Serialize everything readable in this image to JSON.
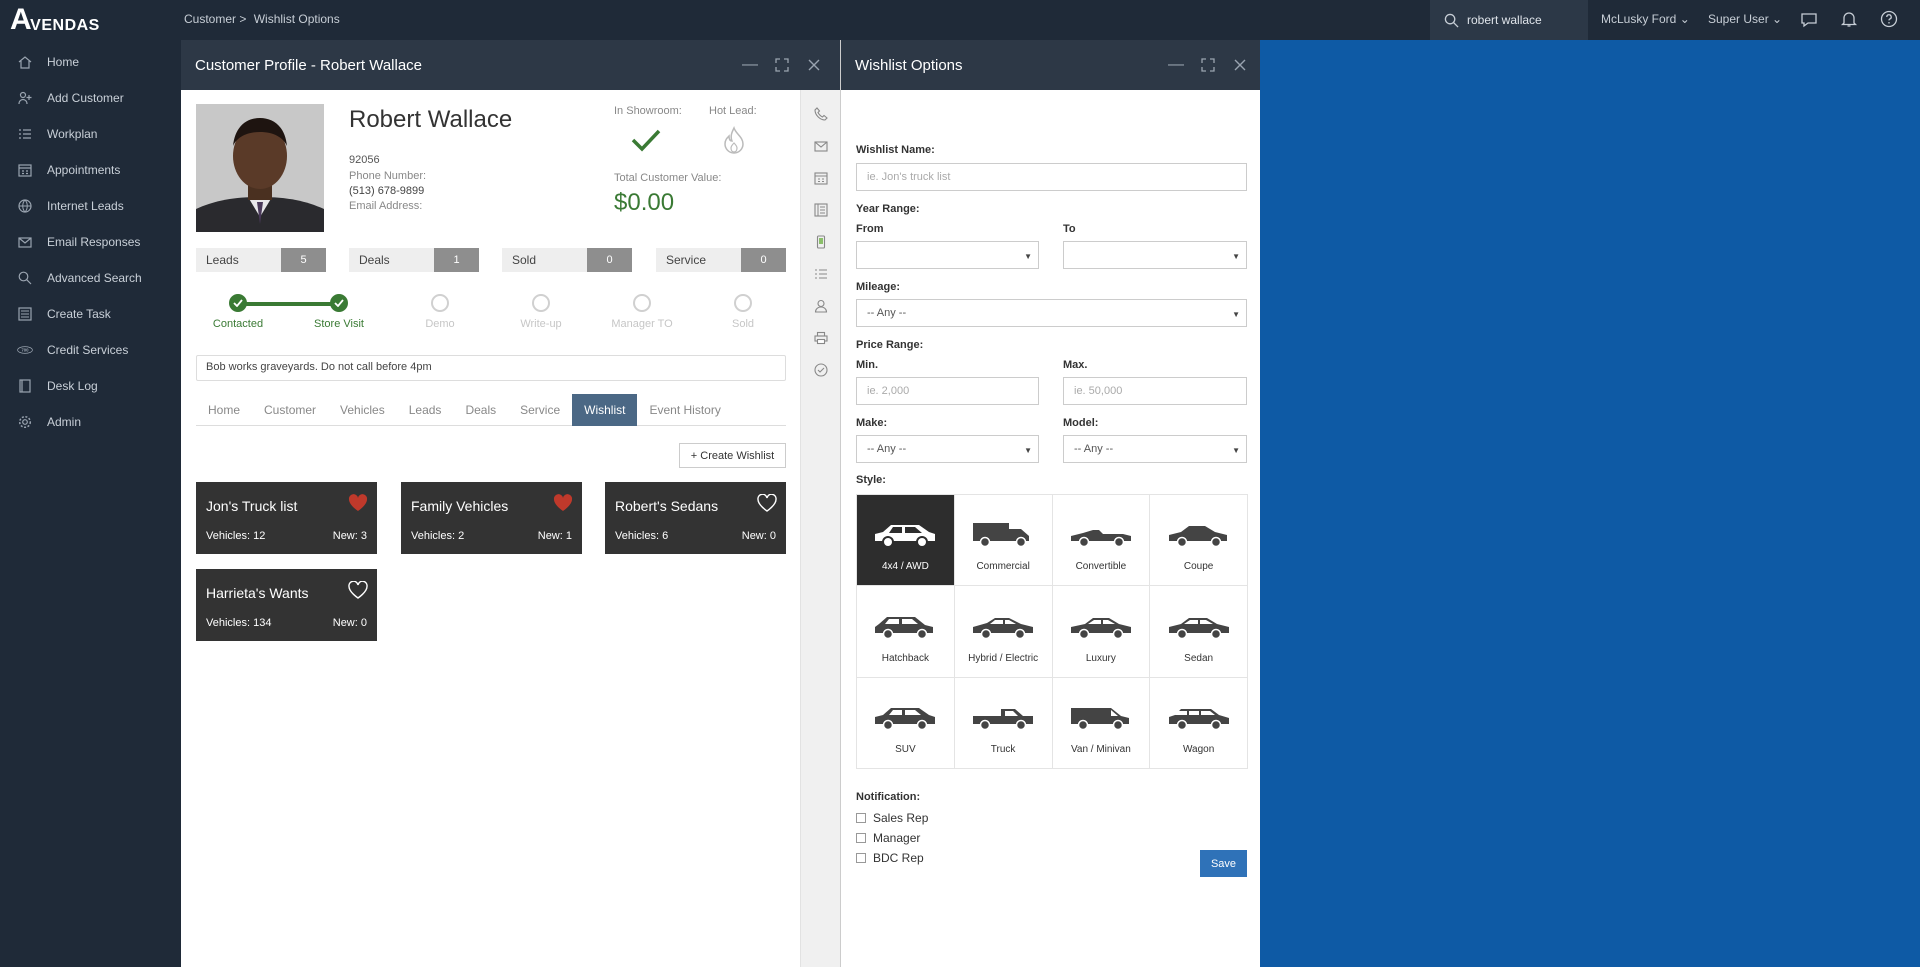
{
  "app": {
    "logo": "VENDAS",
    "logo_letter": "A"
  },
  "breadcrumb": {
    "items": [
      "Customer >",
      "Wishlist Options"
    ]
  },
  "topbar": {
    "search_value": "robert wallace",
    "dealer": "McLusky Ford",
    "user": "Super User"
  },
  "sidebar": {
    "items": [
      {
        "label": "Home",
        "icon": "home-icon"
      },
      {
        "label": "Add Customer",
        "icon": "add-user-icon"
      },
      {
        "label": "Workplan",
        "icon": "list-icon"
      },
      {
        "label": "Appointments",
        "icon": "calendar-icon"
      },
      {
        "label": "Internet Leads",
        "icon": "globe-icon"
      },
      {
        "label": "Email Responses",
        "icon": "envelope-icon"
      },
      {
        "label": "Advanced Search",
        "icon": "search-icon"
      },
      {
        "label": "Create Task",
        "icon": "task-icon"
      },
      {
        "label": "Credit Services",
        "icon": "credit-icon"
      },
      {
        "label": "Desk Log",
        "icon": "book-icon"
      },
      {
        "label": "Admin",
        "icon": "gear-icon"
      }
    ]
  },
  "profile": {
    "title": "Customer Profile - Robert Wallace",
    "name": "Robert Wallace",
    "zip": "92056",
    "phone_label": "Phone Number:",
    "phone": "(513) 678-9899",
    "email_label": "Email Address:",
    "showroom_label": "In Showroom:",
    "hotlead_label": "Hot Lead:",
    "tcv_label": "Total Customer Value:",
    "tcv": "$0.00",
    "stats": [
      {
        "label": "Leads",
        "value": "5"
      },
      {
        "label": "Deals",
        "value": "1"
      },
      {
        "label": "Sold",
        "value": "0"
      },
      {
        "label": "Service",
        "value": "0"
      }
    ],
    "steps": [
      {
        "label": "Contacted",
        "done": true
      },
      {
        "label": "Store Visit",
        "done": true
      },
      {
        "label": "Demo",
        "done": false
      },
      {
        "label": "Write-up",
        "done": false
      },
      {
        "label": "Manager TO",
        "done": false
      },
      {
        "label": "Sold",
        "done": false
      }
    ],
    "notes": "Bob works graveyards. Do not call before 4pm",
    "tabs": [
      "Home",
      "Customer",
      "Vehicles",
      "Leads",
      "Deals",
      "Service",
      "Wishlist",
      "Event History"
    ],
    "active_tab": "Wishlist",
    "create_wishlist": "+ Create Wishlist",
    "wishlists": [
      {
        "title": "Jon's Truck list",
        "vehicles": "Vehicles: 12",
        "new": "New: 3",
        "favorite": true
      },
      {
        "title": "Family Vehicles",
        "vehicles": "Vehicles: 2",
        "new": "New: 1",
        "favorite": true
      },
      {
        "title": "Robert's Sedans",
        "vehicles": "Vehicles: 6",
        "new": "New: 0",
        "favorite": false
      },
      {
        "title": "Harrieta's Wants",
        "vehicles": "Vehicles: 134",
        "new": "New: 0",
        "favorite": false
      }
    ],
    "rail_icons": [
      "phone-icon",
      "envelope-icon",
      "calendar-icon",
      "document-icon",
      "mobile-icon",
      "list-icon",
      "person-icon",
      "printer-icon",
      "check-circle-icon"
    ]
  },
  "wishlist": {
    "title": "Wishlist Options",
    "name_label": "Wishlist Name:",
    "name_placeholder": "ie. Jon's truck list",
    "year_label": "Year Range:",
    "from_label": "From",
    "to_label": "To",
    "from_value": "",
    "to_value": "",
    "mileage_label": "Mileage:",
    "mileage_value": "-- Any --",
    "price_label": "Price Range:",
    "min_label": "Min.",
    "max_label": "Max.",
    "min_placeholder": "ie. 2,000",
    "max_placeholder": "ie. 50,000",
    "make_label": "Make:",
    "model_label": "Model:",
    "make_value": "-- Any --",
    "model_value": "-- Any --",
    "style_label": "Style:",
    "styles": [
      "4x4 / AWD",
      "Commercial",
      "Convertible",
      "Coupe",
      "Hatchback",
      "Hybrid / Electric",
      "Luxury",
      "Sedan",
      "SUV",
      "Truck",
      "Van / Minivan",
      "Wagon"
    ],
    "active_style": "4x4 / AWD",
    "notification_label": "Notification:",
    "notifications": [
      "Sales Rep",
      "Manager",
      "BDC Rep"
    ],
    "save": "Save"
  },
  "colors": {
    "accent": "#3a7a34",
    "nav_bg": "#1f2a38",
    "active_tab": "#4b6885",
    "background": "#0e5aa5",
    "save": "#2f72b8"
  }
}
